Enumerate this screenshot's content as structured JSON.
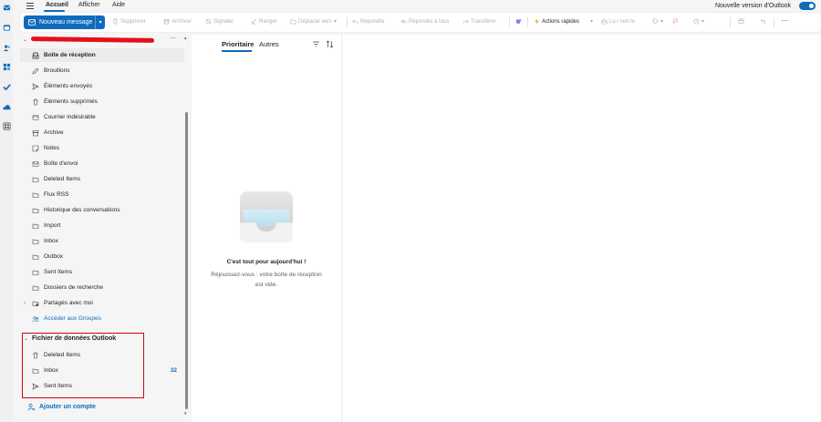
{
  "header": {
    "tabs": [
      {
        "label": "Accueil"
      },
      {
        "label": "Afficher"
      },
      {
        "label": "Aide"
      }
    ],
    "new_version_label": "Nouvelle version d'Outlook"
  },
  "ribbon": {
    "new_message_label": "Nouveau message",
    "buttons": [
      {
        "label": "Supprimer"
      },
      {
        "label": "Archiver"
      },
      {
        "label": "Signaler"
      },
      {
        "label": "Ranger"
      },
      {
        "label": "Déplacer vers"
      },
      {
        "label": "Répondre"
      },
      {
        "label": "Répondre à tous"
      },
      {
        "label": "Transférer"
      },
      {
        "label": "Actions rapides"
      },
      {
        "label": "Lu / non lu"
      }
    ],
    "more_label": "···"
  },
  "folders": {
    "primary": [
      {
        "label": "Boîte de réception",
        "icon": "inbox-icon"
      },
      {
        "label": "Brouillons",
        "icon": "pencil-icon"
      },
      {
        "label": "Éléments envoyés",
        "icon": "send-icon"
      },
      {
        "label": "Éléments supprimés",
        "icon": "trash-icon"
      },
      {
        "label": "Courrier indésirable",
        "icon": "junk-icon"
      },
      {
        "label": "Archive",
        "icon": "archive-icon"
      },
      {
        "label": "Notes",
        "icon": "note-icon"
      },
      {
        "label": "Boîte d'envoi",
        "icon": "outbox-icon"
      },
      {
        "label": "Deleted Items",
        "icon": "folder-icon"
      },
      {
        "label": "Flux RSS",
        "icon": "folder-icon"
      },
      {
        "label": "Historique des conversations",
        "icon": "folder-icon"
      },
      {
        "label": "Import",
        "icon": "folder-icon"
      },
      {
        "label": "Inbox",
        "icon": "folder-icon"
      },
      {
        "label": "Outbox",
        "icon": "folder-icon"
      },
      {
        "label": "Sent Items",
        "icon": "folder-icon"
      },
      {
        "label": "Dossiers de recherche",
        "icon": "folder-icon"
      },
      {
        "label": "Partagés avec moi",
        "icon": "shared-icon"
      },
      {
        "label": "Accéder aux Groupes",
        "icon": "groups-icon"
      }
    ],
    "datafile_title": "Fichier de données Outlook",
    "datafile": [
      {
        "label": "Deleted Items",
        "icon": "trash-icon",
        "count": ""
      },
      {
        "label": "Inbox",
        "icon": "folder-icon",
        "count": "32"
      },
      {
        "label": "Sent Items",
        "icon": "send-icon",
        "count": ""
      }
    ],
    "add_account_label": "Ajouter un compte"
  },
  "message_list": {
    "tabs": [
      {
        "label": "Prioritaire"
      },
      {
        "label": "Autres"
      }
    ],
    "empty_title": "C'est tout pour aujourd'hui !",
    "empty_subtitle": "Réjouissez-vous : votre boîte de réception est vide."
  },
  "colors": {
    "accent": "#0f6cbd",
    "highlight_box": "#d0021b"
  }
}
